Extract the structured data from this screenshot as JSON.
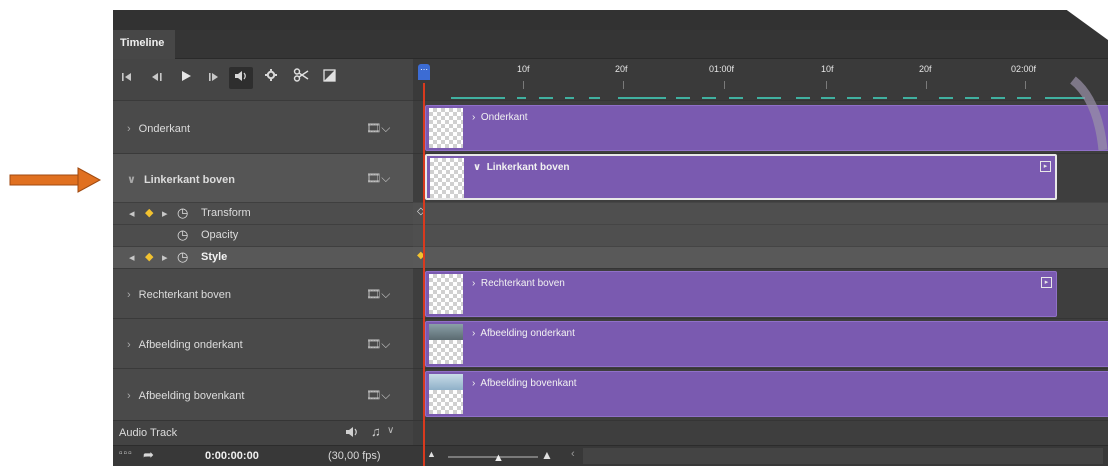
{
  "panel": {
    "tab_label": "Timeline",
    "controls": {
      "first_frame_icon": "first-frame-icon",
      "prev_frame_icon": "previous-frame-icon",
      "play_icon": "play-icon",
      "next_frame_icon": "next-frame-icon",
      "mute_icon": "speaker-icon",
      "settings_icon": "gear-icon",
      "split_icon": "scissors-icon",
      "transition_icon": "transition-icon"
    },
    "ruler": {
      "labels": [
        "10f",
        "20f",
        "01:00f",
        "10f",
        "20f",
        "02:00f"
      ]
    },
    "tracks": [
      {
        "name": "Onderkant",
        "clip_label": "Onderkant",
        "expanded": false
      },
      {
        "name": "Linkerkant boven",
        "clip_label": "Linkerkant boven",
        "expanded": true
      },
      {
        "name": "Rechterkant boven",
        "clip_label": "Rechterkant boven",
        "expanded": false
      },
      {
        "name": "Afbeelding onderkant",
        "clip_label": "Afbeelding onderkant",
        "expanded": false
      },
      {
        "name": "Afbeelding bovenkant",
        "clip_label": "Afbeelding bovenkant",
        "expanded": false
      }
    ],
    "properties": [
      {
        "name": "Transform",
        "selected": false
      },
      {
        "name": "Opacity",
        "selected": false
      },
      {
        "name": "Style",
        "selected": true
      }
    ],
    "audio_track_label": "Audio Track",
    "status": {
      "timecode": "0:00:00:00",
      "fps": "(30,00 fps)"
    },
    "colors": {
      "clip": "#7a5ab0",
      "playhead": "#d83a1e",
      "keyframe": "#f2c230",
      "work_area_dash": "#40b0a0",
      "annotation_arrow": "#e07020"
    }
  }
}
